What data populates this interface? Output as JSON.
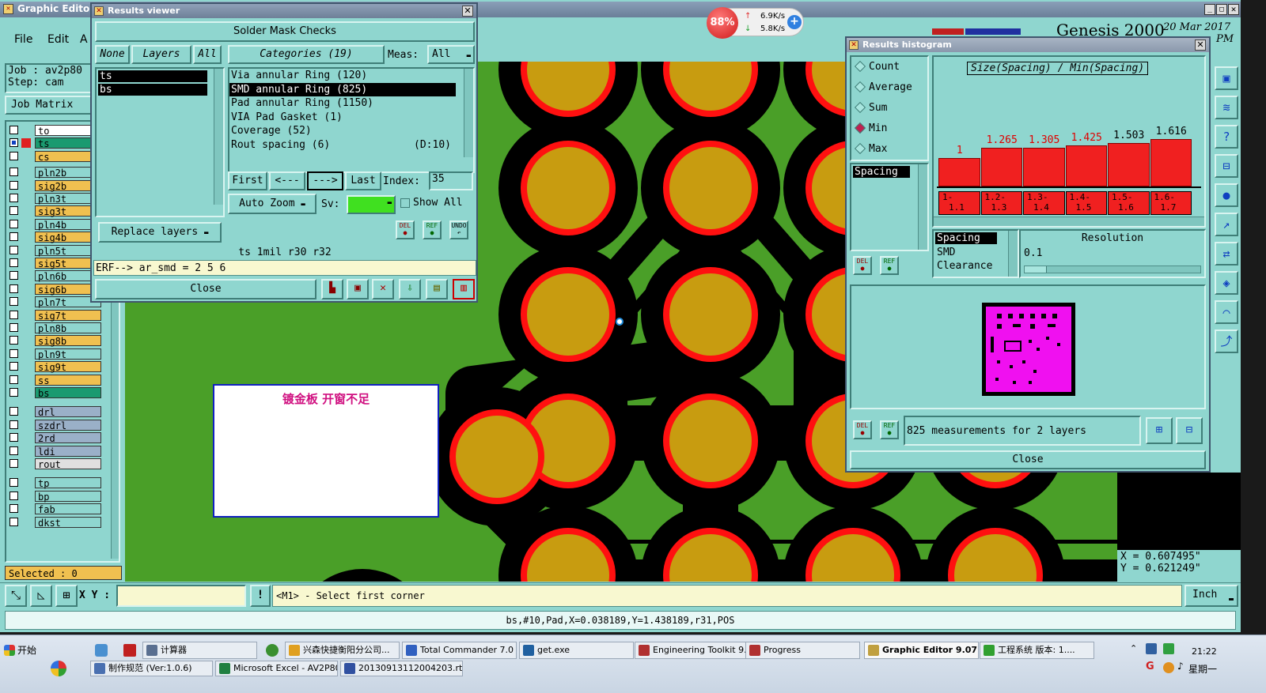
{
  "app": {
    "title": "Graphic Editor 9",
    "genesis_label": "Genesis 2000",
    "date_label": "20 Mar 2017",
    "time_label": "PM",
    "menu": [
      "File",
      "Edit",
      "A"
    ]
  },
  "job": {
    "job_label": "Job : av2p80",
    "step_label": "Step: cam",
    "matrix_button": "Job Matrix",
    "selected": "Selected : 0"
  },
  "layers": [
    {
      "name": "to",
      "color": "#ffffff"
    },
    {
      "name": "ts",
      "color": "#1a9a70"
    },
    {
      "name": "cs",
      "color": "#f0c050"
    },
    {
      "name": "pln2b",
      "color": "#8fd6cf"
    },
    {
      "name": "sig2b",
      "color": "#f0c050"
    },
    {
      "name": "pln3t",
      "color": "#8fd6cf"
    },
    {
      "name": "sig3t",
      "color": "#f0c050"
    },
    {
      "name": "pln4b",
      "color": "#8fd6cf"
    },
    {
      "name": "sig4b",
      "color": "#f0c050"
    },
    {
      "name": "pln5t",
      "color": "#8fd6cf"
    },
    {
      "name": "sig5t",
      "color": "#f0c050"
    },
    {
      "name": "pln6b",
      "color": "#8fd6cf"
    },
    {
      "name": "sig6b",
      "color": "#f0c050"
    },
    {
      "name": "pln7t",
      "color": "#8fd6cf"
    },
    {
      "name": "sig7t",
      "color": "#f0c050"
    },
    {
      "name": "pln8b",
      "color": "#8fd6cf"
    },
    {
      "name": "sig8b",
      "color": "#f0c050"
    },
    {
      "name": "pln9t",
      "color": "#8fd6cf"
    },
    {
      "name": "sig9t",
      "color": "#f0c050"
    },
    {
      "name": "ss",
      "color": "#f0c050"
    },
    {
      "name": "bs",
      "color": "#1a9a70"
    },
    {
      "name": "drl",
      "color": "#9ab0c8"
    },
    {
      "name": "szdrl",
      "color": "#9ab0c8"
    },
    {
      "name": "2rd",
      "color": "#9ab0c8"
    },
    {
      "name": "ldi",
      "color": "#9ab0c8"
    },
    {
      "name": "rout",
      "color": "#e0e0e0"
    },
    {
      "name": "tp",
      "color": "#8fd6cf"
    },
    {
      "name": "bp",
      "color": "#8fd6cf"
    },
    {
      "name": "fab",
      "color": "#8fd6cf"
    },
    {
      "name": "dkst",
      "color": "#8fd6cf"
    }
  ],
  "results_viewer": {
    "title": "Results viewer",
    "header": "Solder Mask Checks",
    "none_btn": "None",
    "layers_btn": "Layers",
    "all_btn": "All",
    "layer_items": [
      "ts",
      "bs"
    ],
    "categories_btn": "Categories (19)",
    "meas_label": "Meas:",
    "meas_value": "All",
    "categories": [
      {
        "label": "Via annular Ring (120)",
        "extra": ""
      },
      {
        "label": "SMD annular Ring (825)",
        "extra": ""
      },
      {
        "label": "Pad annular Ring (1150)",
        "extra": ""
      },
      {
        "label": "VIA Pad Gasket (1)",
        "extra": ""
      },
      {
        "label": "Coverage (52)",
        "extra": ""
      },
      {
        "label": "Rout spacing (6)",
        "extra": "(D:10)"
      }
    ],
    "first_btn": "First",
    "prev_btn": "<---",
    "next_btn": "--->",
    "last_btn": "Last",
    "index_label": "Index:",
    "index_value": "35",
    "auto_zoom": "Auto Zoom",
    "sv_label": "Sv:",
    "show_all": "Show All",
    "replace_layers": "Replace layers",
    "del_label": "DEL",
    "ref_label": "REF",
    "undo_label": "UNDO",
    "status_line": "ts 1mil   r30   r32",
    "erf_line": "ERF--> ar_smd = 2 5 6",
    "close_btn": "Close"
  },
  "annotation": {
    "text": "镀金板   开窗不足"
  },
  "histogram": {
    "title": "Results histogram",
    "options": [
      {
        "label": "Count",
        "selected": false
      },
      {
        "label": "Average",
        "selected": false
      },
      {
        "label": "Sum",
        "selected": false
      },
      {
        "label": "Min",
        "selected": true
      },
      {
        "label": "Max",
        "selected": false
      }
    ],
    "chart_title": "Size(Spacing) / Min(Spacing)",
    "list_item": "Spacing",
    "bars": [
      {
        "value": "1",
        "range1": "1-",
        "range2": "1.1",
        "height": 0.28,
        "value_color": "#e00000"
      },
      {
        "value": "1.265",
        "range1": "1.2-",
        "range2": "1.3",
        "height": 0.38,
        "value_color": "#e00000"
      },
      {
        "value": "1.305",
        "range1": "1.3-",
        "range2": "1.4",
        "height": 0.38,
        "value_color": "#e00000"
      },
      {
        "value": "1.425",
        "range1": "1.4-",
        "range2": "1.5",
        "height": 0.4,
        "value_color": "#e00000"
      },
      {
        "value": "1.503",
        "range1": "1.5-",
        "range2": "1.6",
        "height": 0.42,
        "value_color": "#000000"
      },
      {
        "value": "1.616",
        "range1": "1.6-",
        "range2": "1.7",
        "height": 0.46,
        "value_color": "#000000"
      }
    ],
    "type_items": [
      "Spacing",
      "SMD",
      "Clearance"
    ],
    "resolution_label": "Resolution",
    "resolution_value": "0.1",
    "measurements": "825 measurements for 2 layers",
    "close_btn": "Close"
  },
  "coords": {
    "x": "X = 0.607495\"",
    "y": "Y = 0.621249\""
  },
  "bottom": {
    "xy_label": "X Y :",
    "prompt": "<M1> - Select first corner",
    "units": "Inch",
    "info": "bs,#10,Pad,X=0.038189,Y=1.438189,r31,POS"
  },
  "netmeter": {
    "percent": "88%",
    "up": "6.9K/s",
    "down": "5.8K/s"
  },
  "taskbar": {
    "start": "开始",
    "row1": [
      {
        "label": "计算器",
        "icon_color": "#5a6f90"
      },
      {
        "label": "兴森快捷衡阳分公司...",
        "icon_color": "#e0a020"
      },
      {
        "label": "Total Commander 7.0 ...",
        "icon_color": "#3060c0"
      },
      {
        "label": "get.exe",
        "icon_color": "#2060a0"
      },
      {
        "label": "Engineering Toolkit 9....",
        "icon_color": "#b03030"
      },
      {
        "label": "Progress",
        "icon_color": "#b03030"
      },
      {
        "label": "Graphic Editor 9.07...",
        "icon_color": "#c0a040"
      },
      {
        "label": "工程系统  版本: 1....",
        "icon_color": "#30a030"
      }
    ],
    "row2": [
      {
        "label": "制作规范 (Ver:1.0.6)",
        "icon_color": "#4a70b0"
      },
      {
        "label": "Microsoft Excel - AV2P80...",
        "icon_color": "#208040"
      },
      {
        "label": "20130913112004203.rtf...",
        "icon_color": "#3050a0"
      }
    ],
    "clock": "21:22",
    "weekday": "星期一"
  }
}
